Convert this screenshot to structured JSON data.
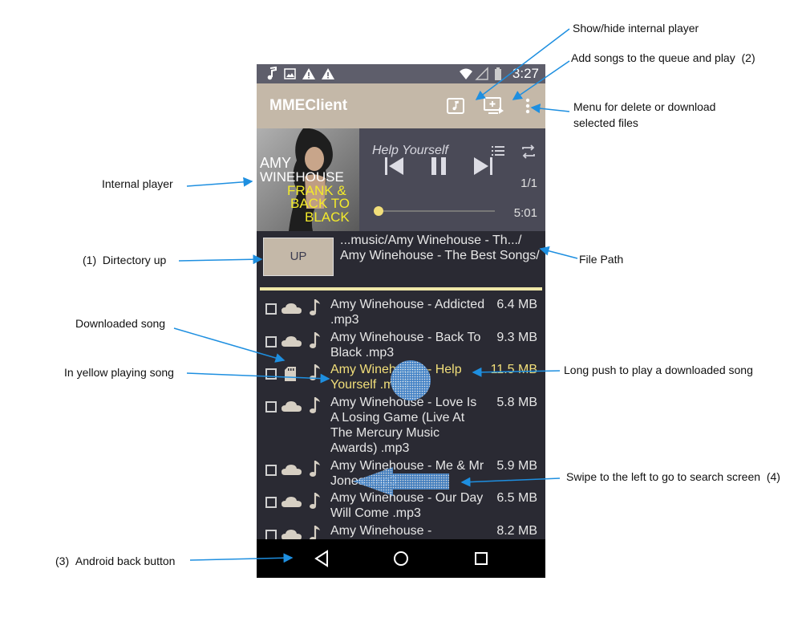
{
  "status_bar": {
    "time": "3:27",
    "icons": [
      "music-note-icon",
      "image-icon",
      "warning-icon",
      "warning-icon",
      "wifi-icon",
      "signal-icon",
      "battery-icon"
    ]
  },
  "app_bar": {
    "title": "MMEClient",
    "actions": [
      "music-player-toggle-icon",
      "queue-add-play-icon",
      "overflow-menu-icon"
    ]
  },
  "player": {
    "album_art_text": {
      "artist_line1": "AMY",
      "artist_line2": "WINEHOUSE",
      "album_line1": "FRANK &",
      "album_line2": "BACK TO",
      "album_line3": "BLACK"
    },
    "song_title": "Help Yourself",
    "track_count": "1/1",
    "duration": "5:01",
    "progress": 0.0
  },
  "path": {
    "up_label": "UP",
    "line1": "...music/Amy Winehouse - Th.../",
    "line2": "Amy Winehouse - The Best Songs/"
  },
  "files": [
    {
      "name": "Amy Winehouse - Addicted .mp3",
      "size": "6.4 MB",
      "storage": "cloud",
      "playing": false
    },
    {
      "name": "Amy Winehouse - Back To Black .mp3",
      "size": "9.3 MB",
      "storage": "cloud",
      "playing": false
    },
    {
      "name": "Amy Winehouse - Help Yourself .mp3",
      "size": "11.5 MB",
      "storage": "sdcard",
      "playing": true
    },
    {
      "name": "Amy Winehouse - Love Is A Losing Game (Live At The Mercury Music Awards) .mp3",
      "size": "5.8 MB",
      "storage": "cloud",
      "playing": false
    },
    {
      "name": "Amy Winehouse - Me & Mr Jones .mp3",
      "size": "5.9 MB",
      "storage": "cloud",
      "playing": false
    },
    {
      "name": "Amy Winehouse - Our Day Will Come .mp3",
      "size": "6.5 MB",
      "storage": "cloud",
      "playing": false
    },
    {
      "name": "Amy Winehouse -",
      "size": "8.2 MB",
      "storage": "cloud",
      "playing": false
    }
  ],
  "annotations": {
    "show_hide": "Show/hide internal player",
    "add_songs": "Add songs to the queue and play",
    "add_songs_num": "(2)",
    "menu_line1": "Menu for delete or download",
    "menu_line2": "selected files",
    "internal_player": "Internal player",
    "dir_up_num": "(1)",
    "dir_up": "Dirtectory up",
    "file_path": "File Path",
    "downloaded": "Downloaded song",
    "yellow": "In yellow playing song",
    "long_push": "Long push to play a downloaded song",
    "swipe": "Swipe to the left to go to search screen",
    "swipe_num": "(4)",
    "back_num": "(3)",
    "back": "Android back button"
  },
  "colors": {
    "app_bar": "#c4b8a8",
    "player_bg": "#4a4a57",
    "list_bg": "#2a2a33",
    "playing_text": "#f2df7a",
    "annotation_arrow": "#1e8fe0"
  }
}
